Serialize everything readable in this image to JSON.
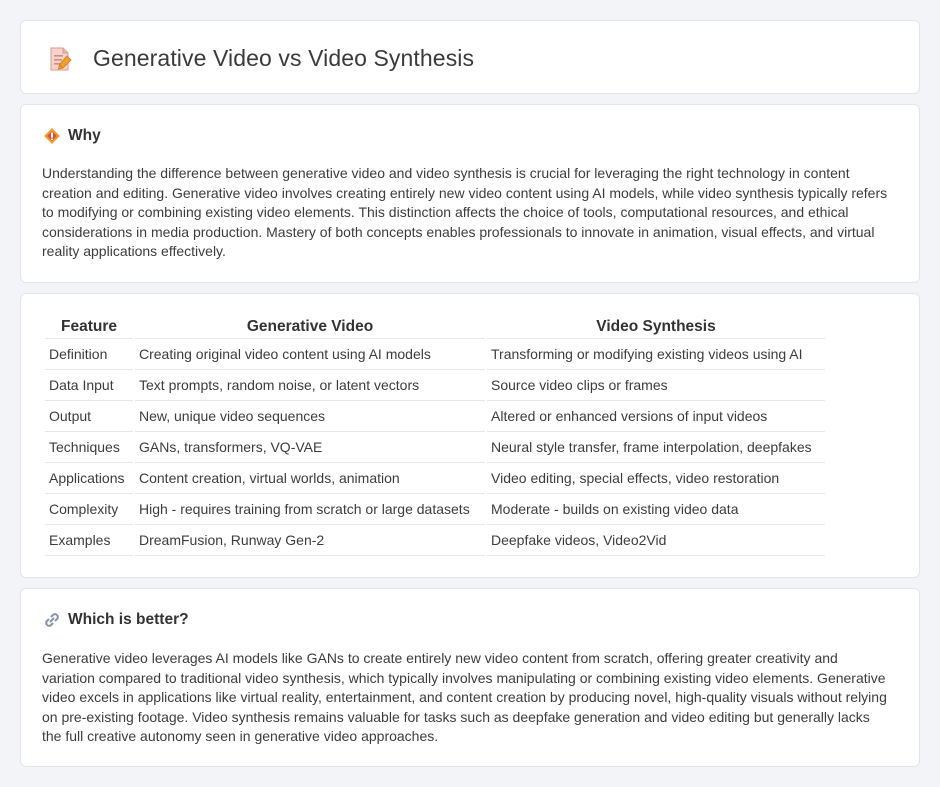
{
  "page": {
    "title": "Generative Video vs Video Synthesis"
  },
  "why": {
    "icon": "diamond-icon",
    "heading": "Why",
    "text": "Understanding the difference between generative video and video synthesis is crucial for leveraging the right technology in content creation and editing. Generative video involves creating entirely new video content using AI models, while video synthesis typically refers to modifying or combining existing video elements. This distinction affects the choice of tools, computational resources, and ethical considerations in media production. Mastery of both concepts enables professionals to innovate in animation, visual effects, and virtual reality applications effectively."
  },
  "comparison": {
    "headers": [
      "Feature",
      "Generative Video",
      "Video Synthesis"
    ],
    "rows": [
      [
        "Definition",
        "Creating original video content using AI models",
        "Transforming or modifying existing videos using AI"
      ],
      [
        "Data Input",
        "Text prompts, random noise, or latent vectors",
        "Source video clips or frames"
      ],
      [
        "Output",
        "New, unique video sequences",
        "Altered or enhanced versions of input videos"
      ],
      [
        "Techniques",
        "GANs, transformers, VQ-VAE",
        "Neural style transfer, frame interpolation, deepfakes"
      ],
      [
        "Applications",
        "Content creation, virtual worlds, animation",
        "Video editing, special effects, video restoration"
      ],
      [
        "Complexity",
        "High - requires training from scratch or large datasets",
        "Moderate - builds on existing video data"
      ],
      [
        "Examples",
        "DreamFusion, Runway Gen-2",
        "Deepfake videos, Video2Vid"
      ]
    ]
  },
  "better": {
    "icon": "link-icon",
    "heading": "Which is better?",
    "text": "Generative video leverages AI models like GANs to create entirely new video content from scratch, offering greater creativity and variation compared to traditional video synthesis, which typically involves manipulating or combining existing video elements. Generative video excels in applications like virtual reality, entertainment, and content creation by producing novel, high-quality visuals without relying on pre-existing footage. Video synthesis remains valuable for tasks such as deepfake generation and video editing but generally lacks the full creative autonomy seen in generative video approaches."
  },
  "colors": {
    "background": "#f3f4f8",
    "card": "#ffffff",
    "border": "#e2e4ea",
    "accent_orange": "#f0a030"
  }
}
